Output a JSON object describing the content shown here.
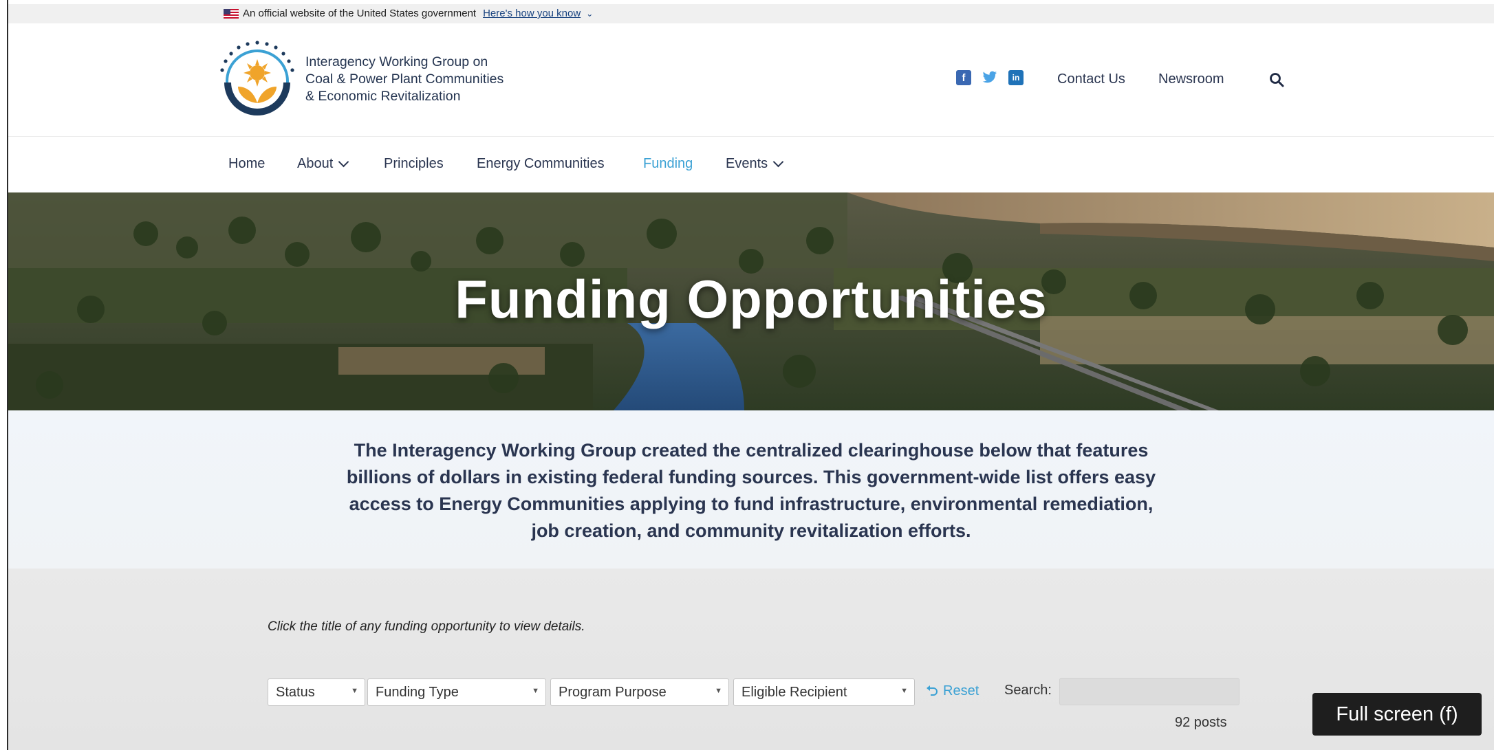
{
  "gov_banner": {
    "text": "An official website of the United States government",
    "link": "Here's how you know"
  },
  "header": {
    "org_name_line1": "Interagency Working Group on",
    "org_name_line2": "Coal & Power Plant Communities",
    "org_name_line3": "& Economic Revitalization",
    "social": [
      "facebook-icon",
      "twitter-icon",
      "linkedin-icon"
    ],
    "contact": "Contact Us",
    "newsroom": "Newsroom"
  },
  "nav": {
    "home": "Home",
    "about": "About",
    "principles": "Principles",
    "energy_communities": "Energy Communities",
    "funding": "Funding",
    "events": "Events",
    "active": "Funding"
  },
  "hero": {
    "title": "Funding Opportunities"
  },
  "intro": {
    "text": "The Interagency Working Group created the centralized clearinghouse below that features billions of dollars in existing federal funding sources. This government-wide list offers easy access to Energy Communities applying to fund infrastructure, environmental remediation, job creation, and community revitalization efforts."
  },
  "filters": {
    "hint": "Click the title of any funding opportunity to view details.",
    "status": "Status",
    "funding_type": "Funding Type",
    "program_purpose": "Program Purpose",
    "eligible_recipient": "Eligible Recipient",
    "reset": "Reset",
    "search_label": "Search:",
    "search_value": "",
    "posts": "92 posts"
  },
  "player": {
    "fullscreen_tooltip": "Full screen (f)"
  },
  "colors": {
    "accent": "#3ba1d4",
    "text": "#2a3550",
    "logo_navy": "#1d3a5c",
    "logo_gold": "#f0a42a"
  }
}
